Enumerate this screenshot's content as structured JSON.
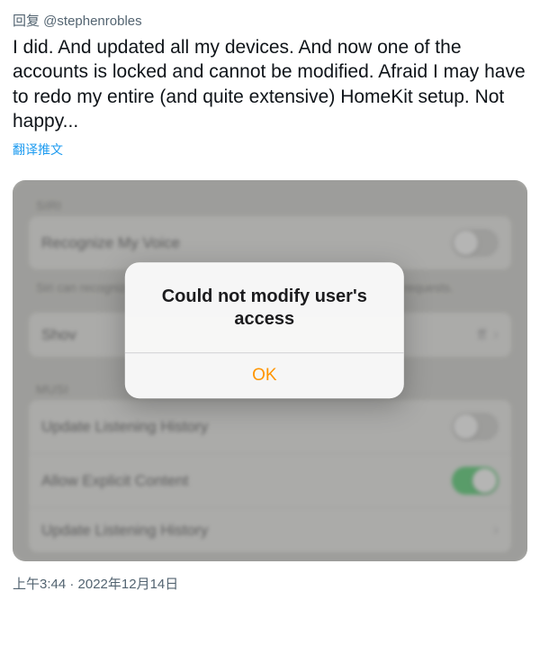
{
  "tweet": {
    "reply_prefix": "回复 ",
    "reply_handle": "@stephenrobles",
    "text": "I did. And updated all my devices. And now one of the accounts is locked and cannot be modified. Afraid I may have to redo my entire (and quite extensive) HomeKit setup. Not happy...",
    "translate": "翻译推文",
    "timestamp": "上午3:44 · 2022年12月14日"
  },
  "settings": {
    "siri_header": "SIRI",
    "recognize_voice": "Recognize My Voice",
    "siri_footnote": "Siri can recognize your voice on Home accessories when you make requests.",
    "show_row_label": "Shov",
    "show_row_value": "ff",
    "music_header": "MUSI",
    "update_history_1": "Update Listening History",
    "allow_explicit": "Allow Explicit Content",
    "update_history_2": "Update Listening History"
  },
  "alert": {
    "title": "Could not modify user's access",
    "ok": "OK"
  }
}
